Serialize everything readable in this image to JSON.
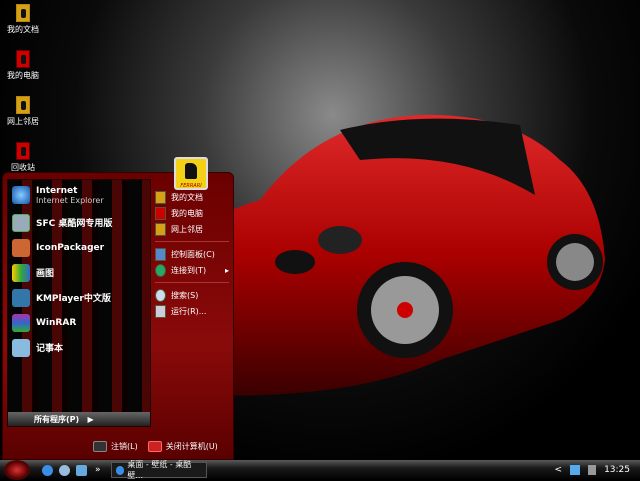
{
  "desktop": {
    "icons": [
      {
        "label": "我的文档"
      },
      {
        "label": "我的电脑"
      },
      {
        "label": "网上邻居"
      },
      {
        "label": "回收站"
      }
    ]
  },
  "start_menu": {
    "logo_text": "FERRARI",
    "pinned": [
      {
        "title": "Internet",
        "subtitle": "Internet Explorer",
        "icon": "ie-icon"
      },
      {
        "title": "SFC 桌酷网专用版",
        "icon": "sfc-icon"
      }
    ],
    "programs": [
      {
        "title": "IconPackager"
      },
      {
        "title": "画图"
      },
      {
        "title": "KMPlayer中文版"
      },
      {
        "title": "WinRAR"
      },
      {
        "title": "记事本"
      }
    ],
    "all_programs": "所有程序(P)",
    "right": [
      {
        "label": "我的文档"
      },
      {
        "label": "我的电脑"
      },
      {
        "label": "网上邻居"
      },
      {
        "label": "控制面板(C)"
      },
      {
        "label": "连接到(T)"
      },
      {
        "label": "搜索(S)"
      },
      {
        "label": "运行(R)..."
      }
    ],
    "logoff": "注销(L)",
    "shutdown": "关闭计算机(U)"
  },
  "taskbar": {
    "task": "桌面 - 壁纸 - 桌酷壁...",
    "more": "»",
    "clock": "13:25",
    "tray_expand": "<"
  }
}
